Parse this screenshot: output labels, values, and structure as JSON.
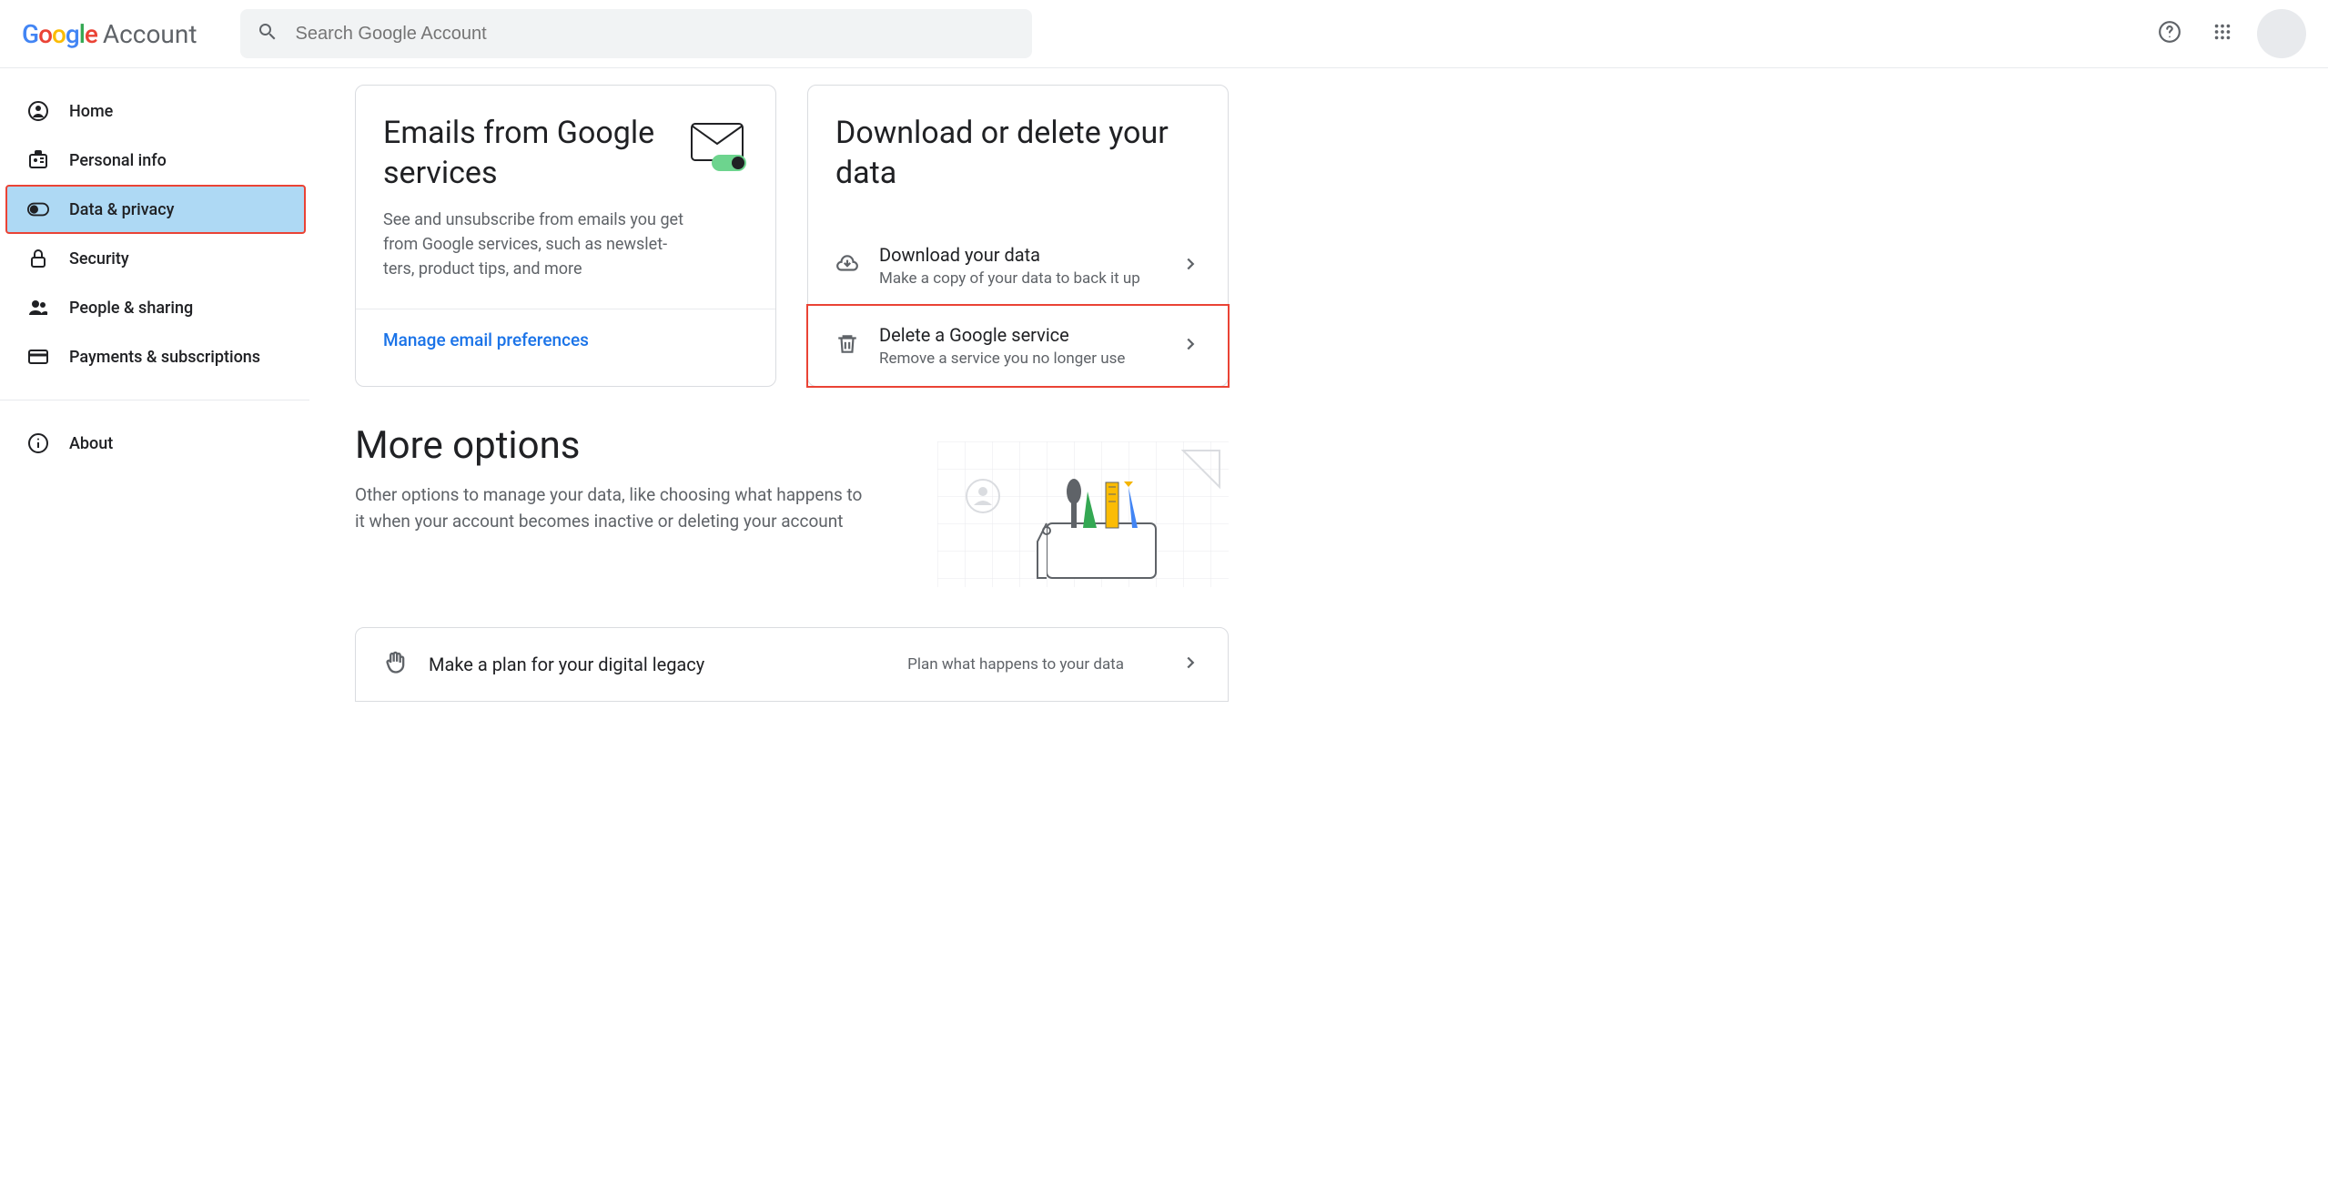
{
  "header": {
    "account_label": "Account",
    "search_placeholder": "Search Google Account"
  },
  "sidebar": {
    "items": [
      {
        "label": "Home"
      },
      {
        "label": "Personal info"
      },
      {
        "label": "Data & privacy"
      },
      {
        "label": "Security"
      },
      {
        "label": "People & sharing"
      },
      {
        "label": "Payments & subscriptions"
      },
      {
        "label": "About"
      }
    ]
  },
  "card_emails": {
    "title": "Emails from Google services",
    "desc": "See and unsubscribe from emails you get from Google services, such as newslet­ters, product tips, and more",
    "link": "Manage email preferences"
  },
  "card_download": {
    "title": "Download or delete your data",
    "options": [
      {
        "title": "Download your data",
        "sub": "Make a copy of your data to back it up"
      },
      {
        "title": "Delete a Google service",
        "sub": "Remove a service you no longer use"
      }
    ]
  },
  "more": {
    "heading": "More options",
    "desc": "Other options to manage your data, like choosing what hap­pens to it when your account becomes inactive or deleting your account",
    "row": {
      "title": "Make a plan for your digital legacy",
      "desc": "Plan what happens to your data"
    }
  }
}
